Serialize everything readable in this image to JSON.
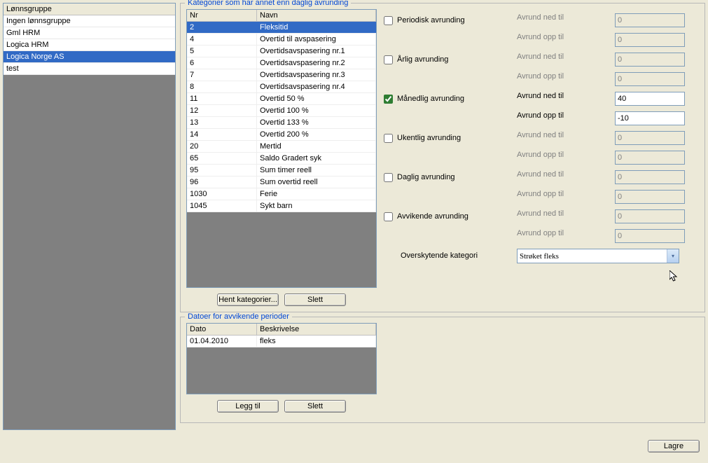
{
  "sidebar": {
    "header": "Lønnsgruppe",
    "items": [
      {
        "label": "Ingen lønnsgruppe",
        "selected": false
      },
      {
        "label": "Gml HRM",
        "selected": false
      },
      {
        "label": "Logica HRM",
        "selected": false
      },
      {
        "label": "Logica Norge AS",
        "selected": true
      },
      {
        "label": "test",
        "selected": false
      }
    ]
  },
  "categories": {
    "title": "Kategorier som har annet enn daglig avrunding",
    "headers": {
      "nr": "Nr",
      "navn": "Navn"
    },
    "rows": [
      {
        "nr": "2",
        "navn": "Fleksitid",
        "selected": true
      },
      {
        "nr": "4",
        "navn": "Overtid til avspasering"
      },
      {
        "nr": "5",
        "navn": "Overtidsavspasering nr.1"
      },
      {
        "nr": "6",
        "navn": "Overtidsavspasering nr.2"
      },
      {
        "nr": "7",
        "navn": "Overtidsavspasering nr.3"
      },
      {
        "nr": "8",
        "navn": "Overtidsavspasering nr.4"
      },
      {
        "nr": "11",
        "navn": "Overtid 50 %"
      },
      {
        "nr": "12",
        "navn": "Overtid 100 %"
      },
      {
        "nr": "13",
        "navn": "Overtid 133 %"
      },
      {
        "nr": "14",
        "navn": "Overtid 200 %"
      },
      {
        "nr": "20",
        "navn": "Mertid"
      },
      {
        "nr": "65",
        "navn": "Saldo Gradert syk"
      },
      {
        "nr": "95",
        "navn": "Sum timer reell"
      },
      {
        "nr": "96",
        "navn": "Sum overtid reell"
      },
      {
        "nr": "1030",
        "navn": "Ferie"
      },
      {
        "nr": "1045",
        "navn": "Sykt barn"
      }
    ],
    "buttons": {
      "fetch": "Hent kategorier...",
      "delete": "Slett"
    }
  },
  "rounding": {
    "labels": {
      "ned": "Avrund ned til",
      "opp": "Avrund opp til"
    },
    "groups": [
      {
        "key": "periodisk",
        "label": "Periodisk avrunding",
        "checked": false,
        "ned": "0",
        "opp": "0"
      },
      {
        "key": "arlig",
        "label": "Årlig avrunding",
        "checked": false,
        "ned": "0",
        "opp": "0"
      },
      {
        "key": "manedlig",
        "label": "Månedlig avrunding",
        "checked": true,
        "ned": "40",
        "opp": "-10"
      },
      {
        "key": "ukentlig",
        "label": "Ukentlig avrunding",
        "checked": false,
        "ned": "0",
        "opp": "0"
      },
      {
        "key": "daglig",
        "label": "Daglig avrunding",
        "checked": false,
        "ned": "0",
        "opp": "0"
      },
      {
        "key": "avvikende",
        "label": "Avvikende avrunding",
        "checked": false,
        "ned": "0",
        "opp": "0"
      }
    ],
    "oversk_label": "Overskytende kategori",
    "oversk_value": "Strøket fleks"
  },
  "dates": {
    "title": "Datoer for avvikende perioder",
    "headers": {
      "dato": "Dato",
      "besk": "Beskrivelse"
    },
    "rows": [
      {
        "dato": "01.04.2010",
        "besk": "fleks"
      }
    ],
    "buttons": {
      "add": "Legg til",
      "delete": "Slett"
    }
  },
  "footer": {
    "save": "Lagre"
  }
}
